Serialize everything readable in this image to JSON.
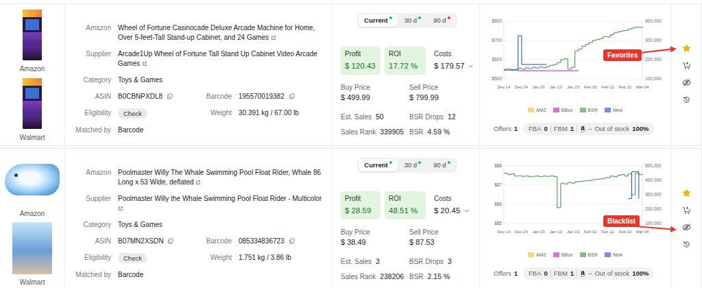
{
  "products": [
    {
      "images": [
        {
          "source": "Amazon",
          "kind": "cabinet"
        },
        {
          "source": "Walmart",
          "kind": "cabinet"
        }
      ],
      "favorite": true,
      "title_label": "Amazon",
      "title": "Wheel of Fortune Casinocade Deluxe Arcade Machine for Home, Over 5-feet-Tall Stand-up Cabinet, and 24 Games",
      "supplier_label": "Supplier",
      "supplier": "Arcade1Up Wheel of Fortune Tall Stand Up Cabinet Video Arcade Games",
      "category_label": "Category",
      "category": "Toys & Games",
      "asin_label": "ASIN",
      "asin": "B0CBNPXDL8",
      "barcode_label": "Barcode",
      "barcode": "195570019382",
      "eligibility_label": "Eligibility",
      "eligibility": "Check",
      "weight_label": "Weight",
      "weight": "30.391 kg / 67.00 lb",
      "matched_label": "Matched by",
      "matched": "Barcode",
      "tabs": [
        {
          "label": "Current",
          "selected": true,
          "color": "#2dbb4e"
        },
        {
          "label": "30 d",
          "selected": false,
          "color": "#2dbb4e"
        },
        {
          "label": "90 d",
          "selected": false,
          "color": "#e53935"
        }
      ],
      "profit": {
        "label": "Profit",
        "value": "$ 120.43"
      },
      "roi": {
        "label": "ROI",
        "value": "17.72 %"
      },
      "costs": {
        "label": "Costs",
        "value": "$ 179.57"
      },
      "buy_price": {
        "label": "Buy Price",
        "value": "$ 499.99"
      },
      "sell_price": {
        "label": "Sell Price",
        "value": "$ 799.99"
      },
      "est_sales": {
        "label": "Est. Sales",
        "value": "50"
      },
      "bsr_drops": {
        "label": "BSR Drops",
        "value": "12"
      },
      "sales_rank": {
        "label": "Sales Rank",
        "value": "339905"
      },
      "bsr": {
        "label": "BSR",
        "value": "4.59 %"
      },
      "chart": {
        "left_ticks": [
          "$800",
          "$700",
          "$600",
          "$500"
        ],
        "right_ticks": [
          "400,000",
          "300,000",
          "200,000",
          "100,000"
        ],
        "x_labels": [
          "Dec 14",
          "Dec 24",
          "Jan 03",
          "Jan 13",
          "Jan 23",
          "Feb 02",
          "Feb 12",
          "Feb 22",
          "Mar 04"
        ],
        "series": [
          {
            "label": "AMZ",
            "color": "#f2c94c",
            "axis": "left",
            "start": 0,
            "values": []
          },
          {
            "label": "BBox",
            "color": "#c23ac2",
            "axis": "left",
            "start": 4,
            "values": [
              542,
              542,
              542,
              542,
              542,
              542,
              542,
              542,
              542,
              542,
              542,
              542,
              542,
              542,
              542,
              542,
              542,
              542
            ]
          },
          {
            "label": "BSR",
            "color": "#5aa05a",
            "axis": "right",
            "start": 0,
            "values": [
              150000,
              152000,
              148000,
              150000,
              155000,
              150000,
              158000,
              153000,
              160000,
              156000,
              162000,
              158000,
              165000,
              170000,
              175000,
              185000,
              200000,
              205000,
              150000,
              160000,
              245000,
              255000,
              270000,
              280000,
              290000,
              300000,
              305000,
              310000,
              320000,
              318000,
              330000,
              340000,
              345000,
              350000,
              352000,
              360000,
              365000,
              370000,
              368000,
              372000
            ]
          },
          {
            "label": "New",
            "color": "#3d63d8",
            "axis": "left",
            "start": 0,
            "values": [
              545,
              545,
              545,
              545,
              725,
              575,
              575,
              575,
              575,
              575,
              575,
              575,
              575
            ]
          }
        ]
      },
      "offers": {
        "label": "Offers",
        "value": "1"
      },
      "fba": {
        "label": "FBA",
        "value": "0"
      },
      "fbm": {
        "label": "FBM",
        "value": "1"
      },
      "amazon_stock": {
        "logo": "a",
        "dash": "–",
        "label": "Out of stock",
        "value": "100%"
      },
      "callout": {
        "text": "Favorites",
        "points_to": "favorite"
      }
    },
    {
      "images": [
        {
          "source": "Amazon",
          "kind": "float"
        },
        {
          "source": "Walmart",
          "kind": "photo"
        }
      ],
      "favorite": true,
      "title_label": "Amazon",
      "title": "Poolmaster Willy The Whale Swimming Pool Float Rider, Whale 86 Long x 53 Wide, deflated",
      "supplier_label": "Supplier",
      "supplier": "Poolmaster Willy the Whale Swimming Pool Float Rider - Multicolor",
      "category_label": "Category",
      "category": "Toys & Games",
      "asin_label": "ASIN",
      "asin": "B07MN2XSDN",
      "barcode_label": "Barcode",
      "barcode": "085334836723",
      "eligibility_label": "Eligibility",
      "eligibility": "Check",
      "weight_label": "Weight",
      "weight": "1.751 kg / 3.86 lb",
      "matched_label": "Matched by",
      "matched": "Barcode",
      "tabs": [
        {
          "label": "Current",
          "selected": true,
          "color": "#2dbb4e"
        },
        {
          "label": "30 d",
          "selected": false,
          "color": "#2dbb4e"
        },
        {
          "label": "90 d",
          "selected": false,
          "color": "#2dbb4e"
        }
      ],
      "profit": {
        "label": "Profit",
        "value": "$ 28.59"
      },
      "roi": {
        "label": "ROI",
        "value": "48.51 %"
      },
      "costs": {
        "label": "Costs",
        "value": "$ 20.45"
      },
      "buy_price": {
        "label": "Buy Price",
        "value": "$ 38.49"
      },
      "sell_price": {
        "label": "Sell Price",
        "value": "$ 87.53"
      },
      "est_sales": {
        "label": "Est. Sales",
        "value": "3"
      },
      "bsr_drops": {
        "label": "BSR Drops",
        "value": "3"
      },
      "sales_rank": {
        "label": "Sales Rank",
        "value": "238206"
      },
      "bsr": {
        "label": "BSR",
        "value": "2.15 %"
      },
      "chart": {
        "left_ticks": [
          "$88",
          "$87",
          "$86",
          "$85"
        ],
        "right_ticks": [
          "500,000",
          "400,000",
          "300,000",
          "200,000",
          "100,000"
        ],
        "x_labels": [
          "Dec 14",
          "Dec 24",
          "Jan 03",
          "Jan 13",
          "Jan 23",
          "Feb 02",
          "Feb 12",
          "Feb 22",
          "Mar 04"
        ],
        "series": [
          {
            "label": "AMZ",
            "color": "#f2c94c",
            "axis": "left",
            "start": 0,
            "values": []
          },
          {
            "label": "BBox",
            "color": "#c23ac2",
            "axis": "left",
            "start": 0,
            "values": []
          },
          {
            "label": "BSR",
            "color": "#5aa05a",
            "axis": "right",
            "start": 0,
            "values": [
              450000,
              440000,
              445000,
              430000,
              432000,
              428000,
              430000,
              425000,
              428000,
              430000,
              426000,
              430000,
              428000,
              431000,
              427000,
              210000,
              380000,
              375000,
              385000,
              380000,
              390000,
              392000,
              395000,
              398000,
              400000,
              405000,
              408000,
              410000,
              415000,
              420000,
              430000,
              425000,
              435000,
              440000,
              430000,
              445000,
              300000,
              450000,
              440000,
              445000
            ]
          },
          {
            "label": "New",
            "color": "#3d63d8",
            "axis": "left",
            "start": 35,
            "values": [
              86.3,
              87.7,
              87.7,
              86.3
            ]
          }
        ]
      },
      "offers": {
        "label": "Offers",
        "value": "1"
      },
      "fba": {
        "label": "FBA",
        "value": "0"
      },
      "fbm": {
        "label": "FBM",
        "value": "1"
      },
      "amazon_stock": {
        "logo": "a",
        "dash": "–",
        "label": "Out of stock",
        "value": "100%"
      },
      "callout": {
        "text": "Blacklist",
        "points_to": "blacklist"
      }
    }
  ]
}
